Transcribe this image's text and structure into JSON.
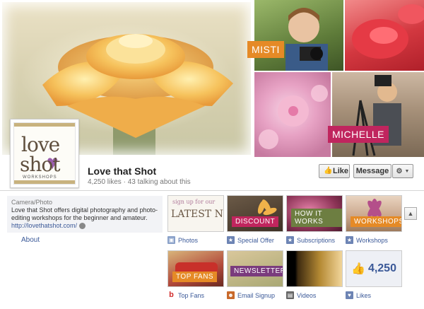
{
  "cover": {
    "tags": {
      "misti": "MISTI",
      "michelle": "MICHELLE"
    },
    "colors": {
      "misti_tag": "#e58a26",
      "michelle_tag": "#c0255e"
    }
  },
  "profile": {
    "logo_love": "love",
    "logo_that": "that",
    "logo_shot": "shot",
    "logo_sub": "WORKSHOPS"
  },
  "header": {
    "name": "Love that Shot",
    "likes": "4,250 likes",
    "talking": "43 talking about this",
    "separator": " · ",
    "like_label": "Like",
    "message_label": "Message",
    "gear_icon": "gear-icon"
  },
  "about": {
    "category": "Camera/Photo",
    "description": "Love that Shot offers digital photography and photo-editing workshops for the beginner and amateur.",
    "url": "http://lovethatshot.com/",
    "link_label": "About"
  },
  "apps": [
    {
      "label": "Photos",
      "thumb_text_1": "sign up for our",
      "thumb_text_2": "LATEST NE",
      "icon": "photos-icon"
    },
    {
      "label": "Special Offer",
      "overlay": "DISCOUNT",
      "icon": "star-icon"
    },
    {
      "label": "Subscriptions",
      "overlay": "HOW IT WORKS",
      "icon": "star-icon"
    },
    {
      "label": "Workshops",
      "overlay": "WORKSHOPS",
      "icon": "star-icon"
    },
    {
      "label": "Top Fans",
      "overlay": "TOP FANS",
      "icon": "b-icon"
    },
    {
      "label": "Email Signup",
      "overlay": "NEWSLETTER",
      "icon": "person-icon"
    },
    {
      "label": "Videos",
      "icon": "film-icon"
    },
    {
      "label": "Likes",
      "count": "4,250",
      "icon": "likes-icon"
    }
  ]
}
